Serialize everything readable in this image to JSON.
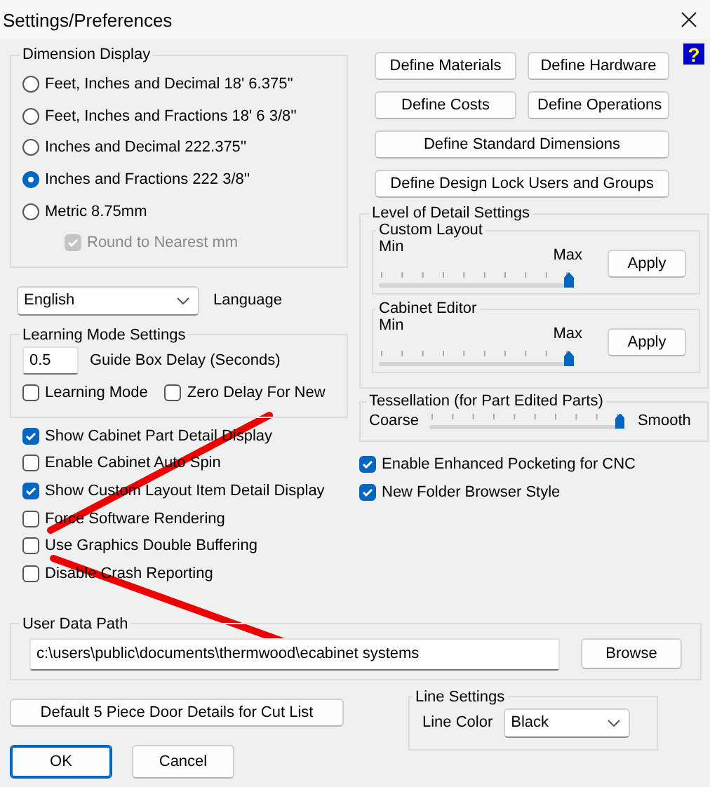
{
  "window": {
    "title": "Settings/Preferences",
    "help": "?"
  },
  "dimension_display": {
    "title": "Dimension Display",
    "options": [
      {
        "label": "Feet, Inches and Decimal 18' 6.375''",
        "selected": false
      },
      {
        "label": "Feet, Inches and Fractions 18' 6 3/8''",
        "selected": false
      },
      {
        "label": "Inches and Decimal 222.375''",
        "selected": false
      },
      {
        "label": "Inches and Fractions 222 3/8''",
        "selected": true
      },
      {
        "label": "Metric 8.75mm",
        "selected": false
      }
    ],
    "round": {
      "label": "Round to Nearest mm",
      "checked": true,
      "disabled": true
    }
  },
  "language": {
    "value": "English",
    "label": "Language"
  },
  "learning_mode": {
    "title": "Learning Mode Settings",
    "delay": {
      "value": "0.5",
      "label": "Guide Box Delay (Seconds)"
    },
    "checkboxes": [
      {
        "label": "Learning Mode",
        "checked": false
      },
      {
        "label": "Zero Delay For New",
        "checked": false
      }
    ]
  },
  "left_checkboxes": [
    {
      "label": "Show Cabinet Part Detail Display",
      "checked": true
    },
    {
      "label": "Enable Cabinet Auto Spin",
      "checked": false
    },
    {
      "label": "Show Custom Layout Item Detail Display",
      "checked": true
    },
    {
      "label": "Force Software Rendering",
      "checked": false
    },
    {
      "label": "Use Graphics Double Buffering",
      "checked": false
    },
    {
      "label": "Disable Crash Reporting",
      "checked": false
    }
  ],
  "define_buttons": [
    {
      "label": "Define Materials",
      "kind": "half"
    },
    {
      "label": "Define Hardware",
      "kind": "half"
    },
    {
      "label": "Define Costs",
      "kind": "half"
    },
    {
      "label": "Define Operations",
      "kind": "half"
    },
    {
      "label": "Define Standard Dimensions",
      "kind": "wide"
    },
    {
      "label": "Define Design Lock Users and Groups",
      "kind": "wide"
    }
  ],
  "level_of_detail": {
    "title": "Level of Detail Settings",
    "groups": [
      {
        "title": "Custom Layout",
        "min": "Min",
        "max": "Max",
        "level": 1,
        "button": "Apply"
      },
      {
        "title": "Cabinet Editor",
        "min": "Min",
        "max": "Max",
        "level": 1,
        "button": "Apply"
      }
    ]
  },
  "tessellation": {
    "title": "Tessellation (for Part Edited Parts)",
    "min": "Coarse",
    "max": "Smooth",
    "level": 1
  },
  "right_checkboxes": [
    {
      "label": "Enable Enhanced Pocketing for CNC",
      "checked": true
    },
    {
      "label": "New Folder Browser Style",
      "checked": true
    }
  ],
  "user_data_path": {
    "title": "User Data Path",
    "value": "c:\\users\\public\\documents\\thermwood\\ecabinet systems",
    "button": "Browse"
  },
  "door_details_button": "Default 5 Piece Door Details for Cut List",
  "line_settings": {
    "title": "Line Settings",
    "label": "Line Color",
    "value": "Black"
  },
  "buttons": [
    {
      "label": "OK",
      "default": true
    },
    {
      "label": "Cancel",
      "default": false
    }
  ]
}
